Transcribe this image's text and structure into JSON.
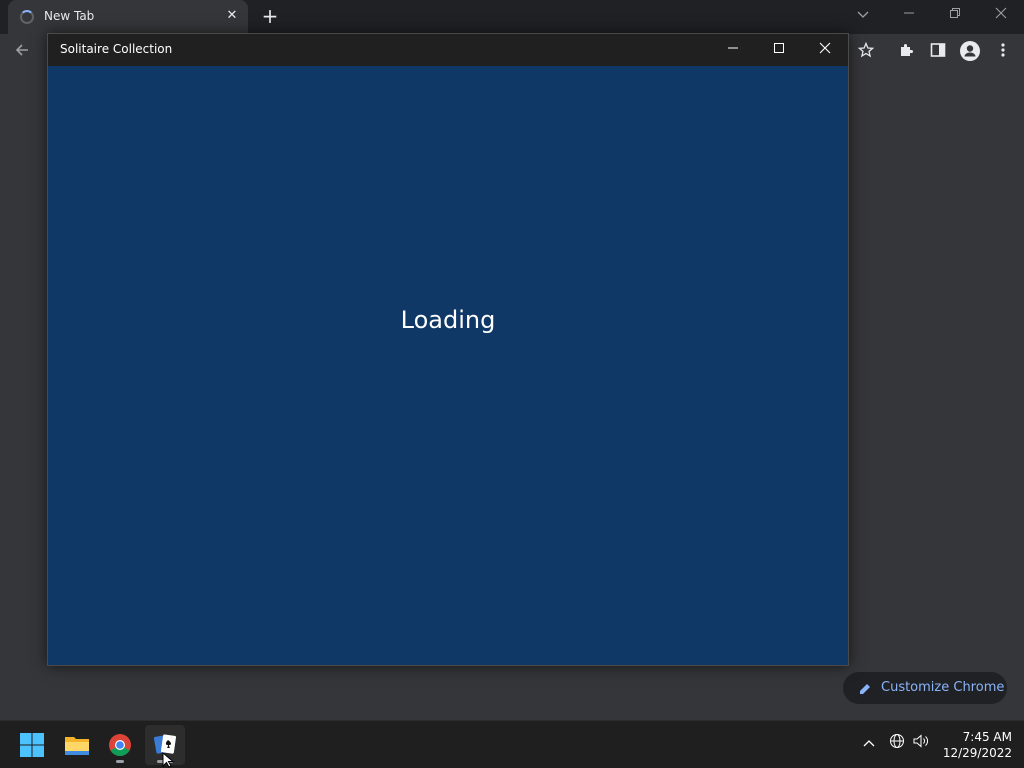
{
  "chrome": {
    "tab_title": "New Tab",
    "tab_close": "✕",
    "new_tab": "+",
    "customize_label": "Customize Chrome"
  },
  "solitaire": {
    "title": "Solitaire Collection",
    "loading_text": "Loading",
    "colors": {
      "background": "#0f3866",
      "titlebar": "#202020"
    }
  },
  "taskbar": {
    "apps": [
      "windows-start",
      "file-explorer",
      "chrome",
      "solitaire-collection"
    ],
    "time": "7:45 AM",
    "date": "12/29/2022"
  }
}
